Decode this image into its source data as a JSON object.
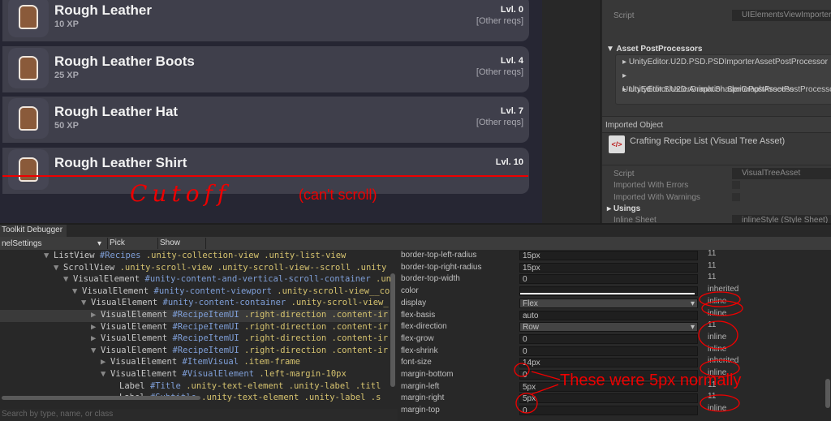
{
  "game": {
    "items": [
      {
        "title": "Rough Leather",
        "xp": "10 XP",
        "level": "Lvl. 0",
        "reqs": "[Other reqs]"
      },
      {
        "title": "Rough Leather Boots",
        "xp": "25 XP",
        "level": "Lvl. 4",
        "reqs": "[Other reqs]"
      },
      {
        "title": "Rough Leather Hat",
        "xp": "50 XP",
        "level": "Lvl. 7",
        "reqs": "[Other reqs]"
      },
      {
        "title": "Rough Leather Shirt",
        "xp": "",
        "level": "Lvl. 10",
        "reqs": ""
      }
    ],
    "annotation_cutoff": "Cutoff",
    "annotation_scroll": "(can't scroll)"
  },
  "inspector": {
    "script_label": "Script",
    "script_value": "UIElementsViewImporter",
    "postprocessors_header": "Asset PostProcessors",
    "postprocessors": [
      "UnityEditor.U2D.PSD.PSDImporterAssetPostProcessor",
      "UnityEditor.ShaderGraph.ShaderGraphAssetPostProcessor",
      "UnityEditor.U2D.Animation.SpritePostProcess"
    ],
    "imported_object": "Imported Object",
    "asset_name": "Crafting Recipe List (Visual Tree Asset)",
    "script2_label": "Script",
    "script2_value": "VisualTreeAsset",
    "errors_label": "Imported With Errors",
    "warnings_label": "Imported With Warnings",
    "usings": "Usings",
    "inline_label": "Inline Sheet",
    "inline_value": "inlineStyle (Style Sheet)"
  },
  "debugger": {
    "tab": "Toolkit Debugger",
    "panel": "nelSettings",
    "pick": "Pick Element",
    "layout": "Show Layout",
    "search_placeholder": "Search by type, name, or class",
    "tree": [
      {
        "type": "ListView",
        "id": "#Recipes",
        "classes": ".unity-collection-view  .unity-list-view",
        "arrow": "▼"
      },
      {
        "type": "ScrollView",
        "id": "",
        "classes": ".unity-scroll-view  .unity-scroll-view--scroll  .unity",
        "arrow": "▼"
      },
      {
        "type": "VisualElement",
        "id": "#unity-content-and-vertical-scroll-container",
        "classes": ".un",
        "arrow": "▼"
      },
      {
        "type": "VisualElement",
        "id": "#unity-content-viewport",
        "classes": ".unity-scroll-view__con",
        "arrow": "▼"
      },
      {
        "type": "VisualElement",
        "id": "#unity-content-container",
        "classes": ".unity-scroll-view_",
        "arrow": "▼"
      },
      {
        "type": "VisualElement",
        "id": "#RecipeItemUI",
        "classes": ".right-direction  .content-ir",
        "arrow": "▶"
      },
      {
        "type": "VisualElement",
        "id": "#RecipeItemUI",
        "classes": ".right-direction  .content-ir",
        "arrow": "▶"
      },
      {
        "type": "VisualElement",
        "id": "#RecipeItemUI",
        "classes": ".right-direction  .content-ir",
        "arrow": "▶"
      },
      {
        "type": "VisualElement",
        "id": "#RecipeItemUI",
        "classes": ".right-direction  .content-ir",
        "arrow": "▼"
      },
      {
        "type": "VisualElement",
        "id": "#ItemVisual",
        "classes": ".item-frame",
        "arrow": "▶"
      },
      {
        "type": "VisualElement",
        "id": "#VisualElement",
        "classes": ".left-margin-10px",
        "arrow": "▼"
      },
      {
        "type": "Label",
        "id": "#Title",
        "classes": ".unity-text-element  .unity-label  .titl",
        "arrow": ""
      },
      {
        "type": "Label",
        "id": "#Subtitle",
        "classes": ".unity-text-element  .unity-label  .s",
        "arrow": ""
      }
    ],
    "props": [
      {
        "name": "border-top-left-radius",
        "value": "15px",
        "spec": "11"
      },
      {
        "name": "border-top-right-radius",
        "value": "15px",
        "spec": "11"
      },
      {
        "name": "border-top-width",
        "value": "0",
        "spec": "11"
      },
      {
        "name": "color",
        "value": "",
        "spec": "inherited"
      },
      {
        "name": "display",
        "value": "Flex",
        "spec": "inline",
        "dd": true
      },
      {
        "name": "flex-basis",
        "value": "auto",
        "spec": "inline"
      },
      {
        "name": "flex-direction",
        "value": "Row",
        "spec": "11",
        "dd": true
      },
      {
        "name": "flex-grow",
        "value": "0",
        "spec": "inline"
      },
      {
        "name": "flex-shrink",
        "value": "0",
        "spec": "inline"
      },
      {
        "name": "font-size",
        "value": "14px",
        "spec": "inherited"
      },
      {
        "name": "margin-bottom",
        "value": "0",
        "spec": "inline"
      },
      {
        "name": "margin-left",
        "value": "5px",
        "spec": "11"
      },
      {
        "name": "margin-right",
        "value": "5px",
        "spec": "11"
      },
      {
        "name": "margin-top",
        "value": "0",
        "spec": "inline"
      }
    ],
    "annotation": "These were 5px normally"
  },
  "colors": {
    "annotation": "#e00000",
    "card": "#3f3f4b",
    "game_bg": "#262633"
  }
}
